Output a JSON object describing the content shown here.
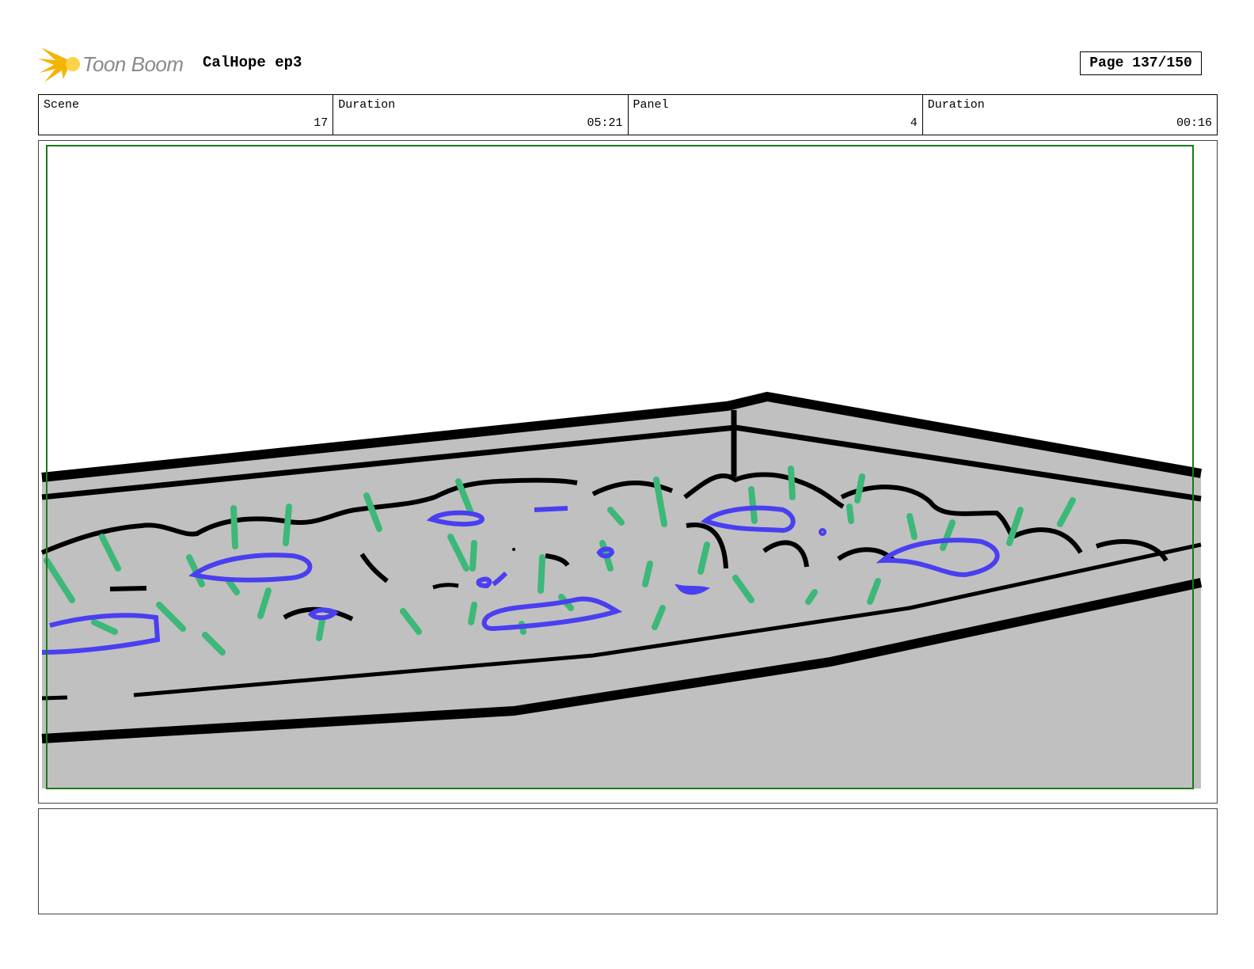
{
  "header": {
    "logo_text": "Toon Boom",
    "project_title": "CalHope ep3",
    "page": "Page 137/150"
  },
  "info": {
    "scene_label": "Scene",
    "scene_value": "17",
    "scene_duration_label": "Duration",
    "scene_duration_value": "05:21",
    "panel_label": "Panel",
    "panel_value": "4",
    "panel_duration_label": "Duration",
    "panel_duration_value": "00:16"
  },
  "colors": {
    "logo_flame": "#f5b400",
    "safe_frame": "#1a7a1a",
    "fill_gray": "#c0c0c0",
    "grass_green": "#3cb878",
    "rock_blue": "#4a3ff0"
  },
  "notes": {
    "text": ""
  }
}
